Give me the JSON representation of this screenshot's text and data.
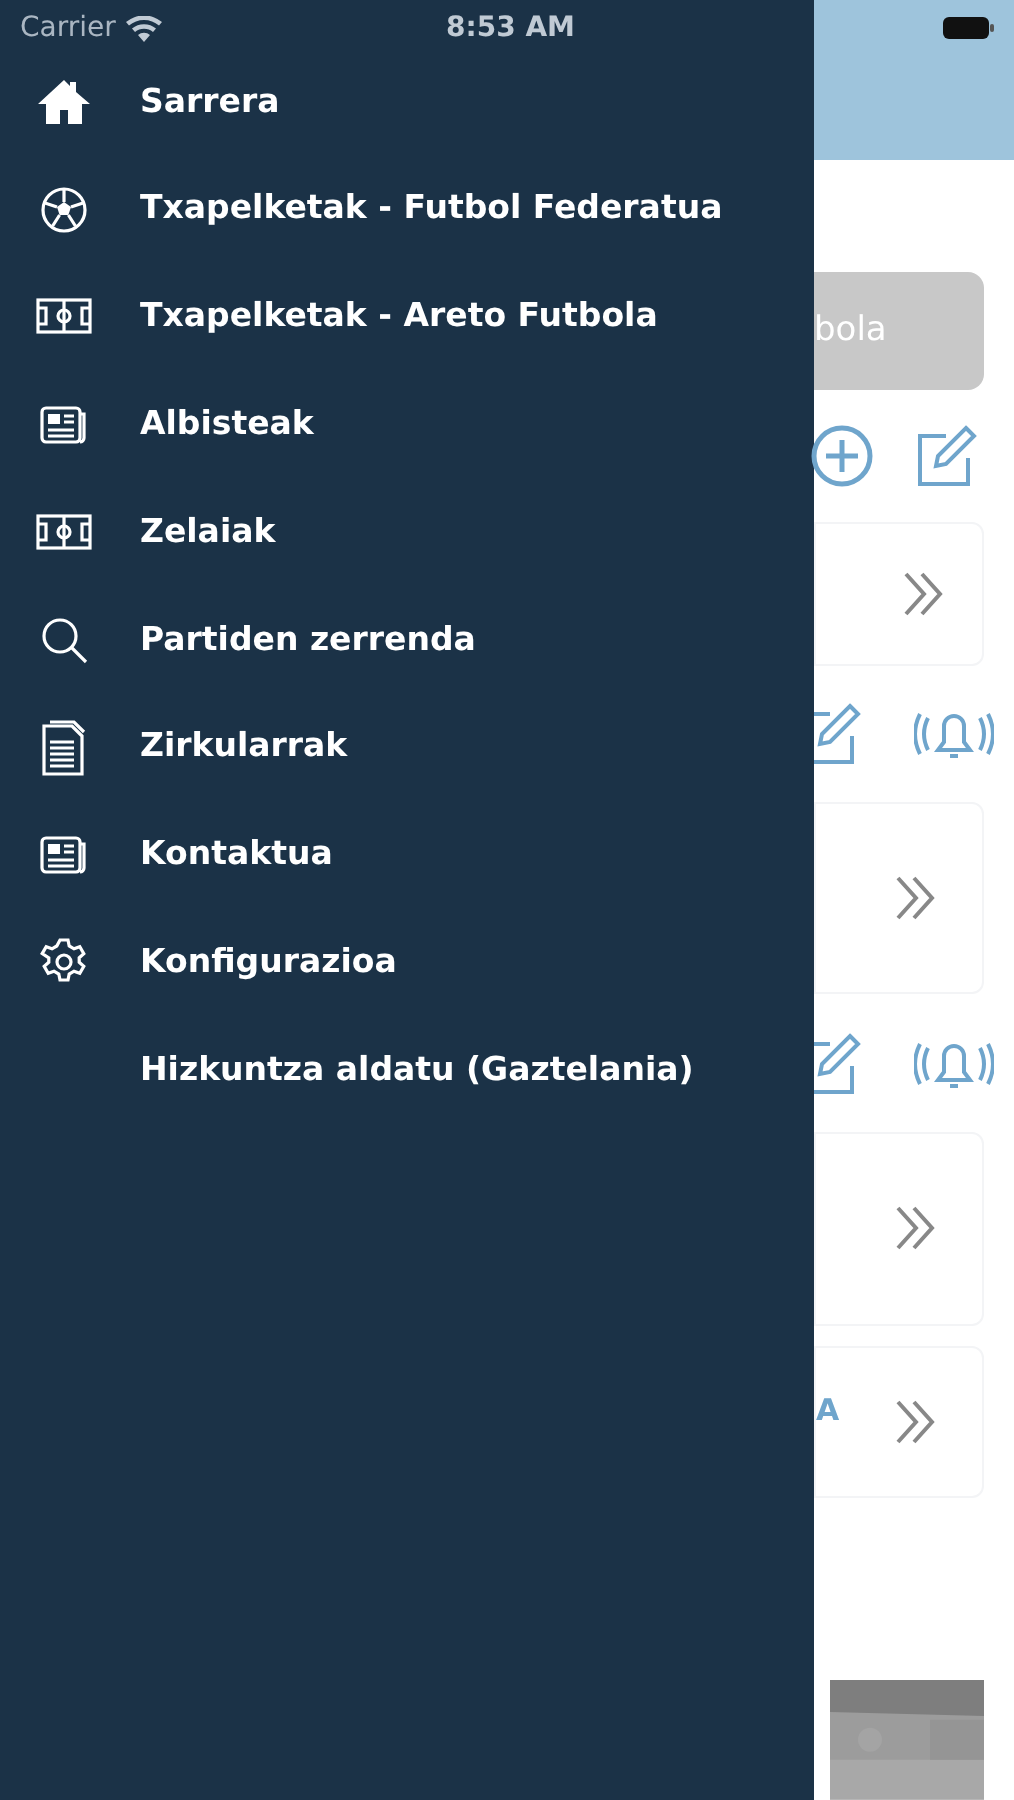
{
  "status_bar": {
    "carrier": "Carrier",
    "time": "8:53 AM"
  },
  "menu": [
    {
      "label": "Sarrera",
      "kind": "home"
    },
    {
      "label": "Txapelketak - Futbol Federatua",
      "kind": "ball"
    },
    {
      "label": "Txapelketak - Areto Futbola",
      "kind": "field"
    },
    {
      "label": "Albisteak",
      "kind": "news"
    },
    {
      "label": "Zelaiak",
      "kind": "field"
    },
    {
      "label": "Partiden zerrenda",
      "kind": "search"
    },
    {
      "label": "Zirkularrak",
      "kind": "document"
    },
    {
      "label": "Kontaktua",
      "kind": "news"
    },
    {
      "label": "Konfigurazioa",
      "kind": "gear"
    },
    {
      "label": "Hizkuntza aldatu (Gaztelania)",
      "kind": "plain"
    }
  ],
  "background": {
    "tab_fragment": "bola",
    "text_fragment": "A"
  }
}
